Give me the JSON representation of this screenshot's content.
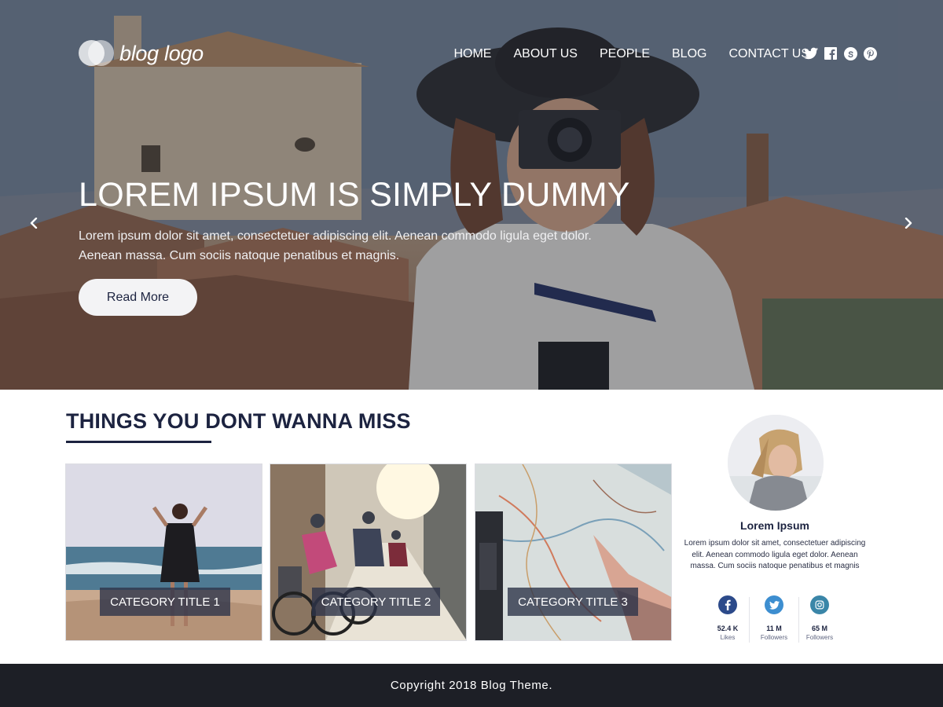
{
  "header": {
    "logo_text": "blog logo",
    "nav": [
      "HOME",
      "ABOUT US",
      "PEOPLE",
      "BLOG",
      "CONTACT US"
    ],
    "social_icons": [
      "twitter-icon",
      "facebook-icon",
      "skype-icon",
      "pinterest-icon"
    ]
  },
  "hero": {
    "title": "LOREM IPSUM IS SIMPLY DUMMY",
    "description": "Lorem ipsum dolor sit amet, consectetuer adipiscing elit. Aenean commodo ligula eget dolor. Aenean massa. Cum sociis natoque penatibus et magnis.",
    "button_label": "Read More",
    "prev_icon": "chevron-left-icon",
    "next_icon": "chevron-right-icon"
  },
  "section": {
    "title": "THINGS YOU DONT WANNA MISS",
    "categories": [
      {
        "label": "CATEGORY TITLE 1"
      },
      {
        "label": "CATEGORY TITLE 2"
      },
      {
        "label": "CATEGORY TITLE 3"
      }
    ]
  },
  "profile": {
    "name": "Lorem Ipsum",
    "bio": "Lorem ipsum dolor sit amet, consectetuer adipiscing elit. Aenean commodo ligula eget dolor. Aenean massa. Cum sociis natoque penatibus et magnis",
    "stats": [
      {
        "icon": "facebook-icon",
        "count": "52.4 K",
        "label": "Likes"
      },
      {
        "icon": "twitter-icon",
        "count": "11 M",
        "label": "Followers"
      },
      {
        "icon": "instagram-icon",
        "count": "65 M",
        "label": "Followers"
      }
    ]
  },
  "footer": {
    "copyright": "Copyright 2018 Blog Theme."
  },
  "colors": {
    "primary": "#1c2340",
    "footer_bg": "#1d1f26",
    "facebook": "#2c4a8a",
    "twitter": "#3d8ed0",
    "instagram": "#3a86a8"
  }
}
